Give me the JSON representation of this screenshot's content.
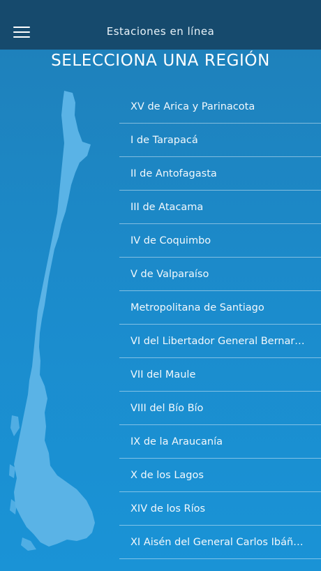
{
  "header": {
    "menu_icon": "hamburger-menu-icon",
    "title": "Estaciones en línea"
  },
  "main": {
    "heading": "SELECCIONA UNA REGIÓN",
    "map_icon": "chile-map-illustration",
    "regions": [
      "XV de Arica y Parinacota",
      "I de Tarapacá",
      "II de Antofagasta",
      "III de Atacama",
      "IV de Coquimbo",
      "V de Valparaíso",
      "Metropolitana de Santiago",
      "VI del Libertador General Bernardo O'Higgins",
      "VII del Maule",
      "VIII del Bío Bío",
      "IX de la Araucanía",
      "X de los Lagos",
      "XIV de los Ríos",
      "XI Aisén del General Carlos Ibáñez del Campo"
    ]
  },
  "colors": {
    "topbar": "#164a6d",
    "background": "#1b8ccd",
    "map_fill": "#5ab3e6",
    "text": "#ffffff"
  }
}
